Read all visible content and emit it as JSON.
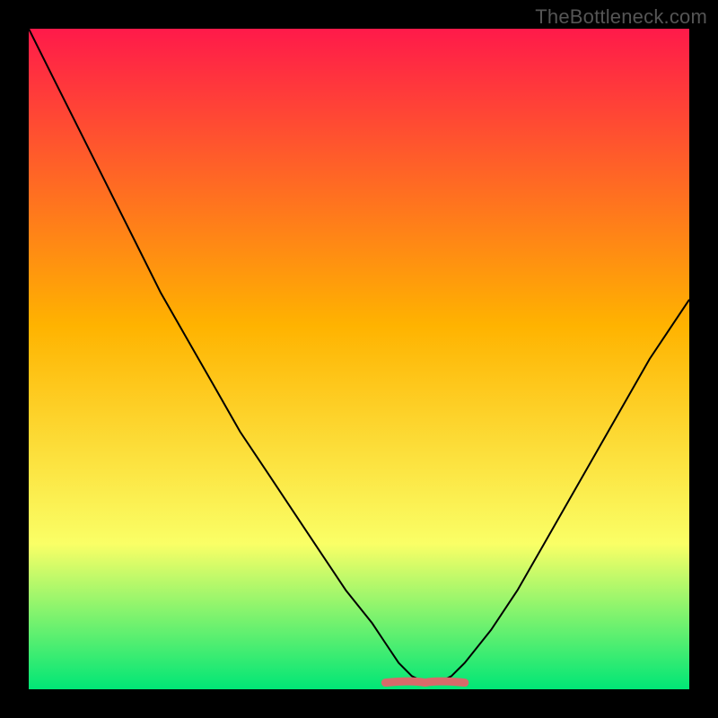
{
  "watermark": "TheBottleneck.com",
  "colors": {
    "frame_bg": "#000000",
    "gradient_top": "#ff1a4a",
    "gradient_mid": "#ffb300",
    "gradient_low": "#faff66",
    "gradient_bottom": "#00e676",
    "curve_stroke": "#000000",
    "band_stroke": "#d86a6a"
  },
  "chart_data": {
    "type": "line",
    "title": "",
    "xlabel": "",
    "ylabel": "",
    "x_range": [
      0,
      100
    ],
    "y_range": [
      0,
      100
    ],
    "series": [
      {
        "name": "bottleneck-curve",
        "x": [
          0,
          4,
          8,
          12,
          16,
          20,
          24,
          28,
          32,
          36,
          40,
          44,
          48,
          52,
          54,
          56,
          58,
          60,
          62,
          64,
          66,
          70,
          74,
          78,
          82,
          86,
          90,
          94,
          98,
          100
        ],
        "y": [
          100,
          92,
          84,
          76,
          68,
          60,
          53,
          46,
          39,
          33,
          27,
          21,
          15,
          10,
          7,
          4,
          2,
          1,
          1,
          2,
          4,
          9,
          15,
          22,
          29,
          36,
          43,
          50,
          56,
          59
        ]
      }
    ],
    "optimal_band": {
      "x_start": 54,
      "x_end": 66,
      "y": 1
    }
  }
}
